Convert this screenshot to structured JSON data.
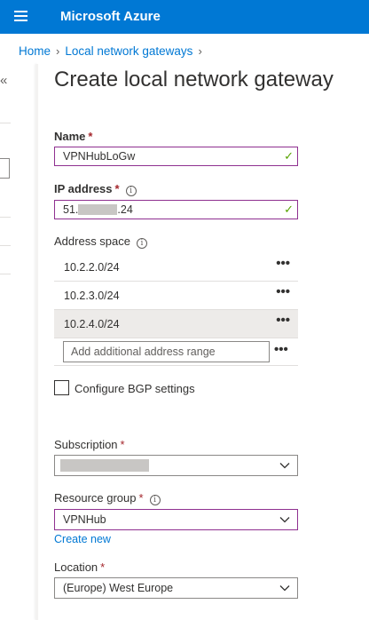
{
  "header": {
    "brand": "Microsoft Azure",
    "menu_icon": "hamburger-icon",
    "accent": "#0078d4"
  },
  "breadcrumb": {
    "items": [
      "Home",
      "Local network gateways"
    ]
  },
  "page": {
    "title": "Create local network gateway"
  },
  "form": {
    "name": {
      "label": "Name",
      "required": "*",
      "value": "VPNHubLoGw",
      "valid_icon": "check-icon"
    },
    "ip_address": {
      "label": "IP address",
      "required": "*",
      "info": "i",
      "value_prefix": "51.",
      "value_suffix": ".24"
    },
    "address_space": {
      "label": "Address space",
      "info": "i",
      "items": [
        "10.2.2.0/24",
        "10.2.3.0/24",
        "10.2.4.0/24"
      ],
      "more": "•••",
      "placeholder": "Add additional address range"
    },
    "bgp": {
      "label": "Configure BGP settings",
      "checked": false
    },
    "subscription": {
      "label": "Subscription",
      "required": "*",
      "value": ""
    },
    "resource_group": {
      "label": "Resource group",
      "required": "*",
      "info": "i",
      "value": "VPNHub",
      "create_new": "Create new"
    },
    "location": {
      "label": "Location",
      "required": "*",
      "value": "(Europe) West Europe"
    }
  },
  "sidebar": {
    "collapse_label": "«"
  }
}
